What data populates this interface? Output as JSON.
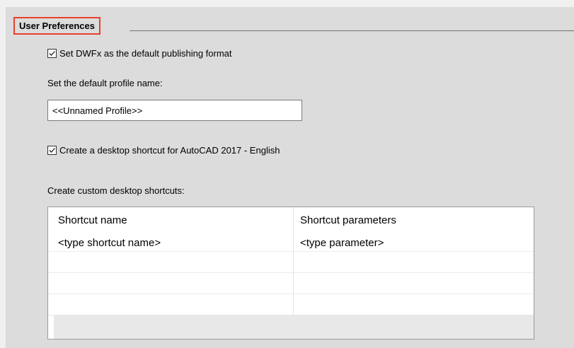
{
  "section": {
    "title": "User Preferences"
  },
  "dwfx_checkbox": {
    "label": "Set DWFx as the default publishing format",
    "checked": true
  },
  "profile": {
    "label": "Set the default profile name:",
    "value": "<<Unnamed Profile>>"
  },
  "desktop_shortcut_checkbox": {
    "label": "Create a desktop shortcut for AutoCAD 2017 - English",
    "checked": true
  },
  "custom_shortcuts": {
    "label": "Create custom desktop shortcuts:",
    "columns": [
      "Shortcut name",
      "Shortcut parameters"
    ],
    "rows": [
      [
        "<type shortcut name>",
        "<type parameter>"
      ],
      [
        "",
        ""
      ],
      [
        "",
        ""
      ],
      [
        "",
        ""
      ]
    ]
  },
  "colors": {
    "highlight": "#e8402a",
    "panel": "#dcdcdc"
  }
}
